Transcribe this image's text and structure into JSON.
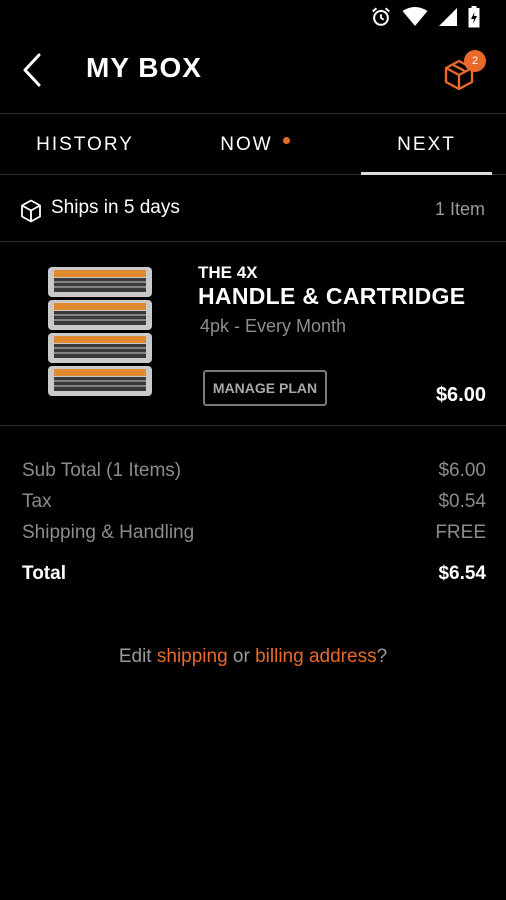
{
  "app": {
    "title": "MY BOX",
    "cart_badge": "2",
    "accent_color": "#e8692a"
  },
  "tabs": [
    {
      "label": "HISTORY"
    },
    {
      "label": "NOW"
    },
    {
      "label": "NEXT"
    }
  ],
  "shipping": {
    "text": "Ships in 5 days",
    "item_count": "1 Item"
  },
  "product": {
    "brand_line": "THE 4X",
    "name": "HANDLE & CARTRIDGE",
    "plan": "4pk - Every Month",
    "manage_label": "MANAGE PLAN",
    "price": "$6.00"
  },
  "summary": {
    "subtotal_label": "Sub Total (1 Items)",
    "subtotal_value": "$6.00",
    "tax_label": "Tax",
    "tax_value": "$0.54",
    "shipping_label": "Shipping & Handling",
    "shipping_value": "FREE",
    "total_label": "Total",
    "total_value": "$6.54"
  },
  "edit": {
    "prefix": "Edit ",
    "shipping_link": "shipping",
    "middle": " or ",
    "billing_link": "billing address",
    "suffix": "?"
  }
}
